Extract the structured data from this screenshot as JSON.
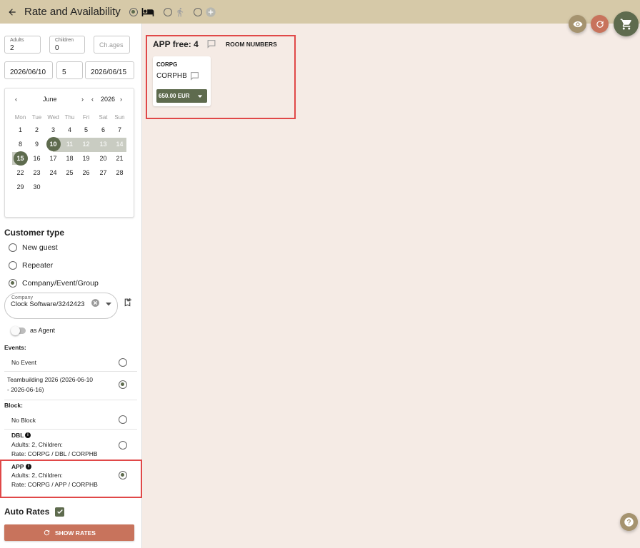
{
  "header": {
    "title": "Rate and Availability"
  },
  "guests": {
    "adults_label": "Adults",
    "adults_value": "2",
    "children_label": "Children",
    "children_value": "0",
    "child_ages_placeholder": "Ch.ages"
  },
  "dates": {
    "arrival": "2026/06/10",
    "nights": "5",
    "departure": "2026/06/15"
  },
  "calendar": {
    "month": "June",
    "year": "2026",
    "weekdays": [
      "Mon",
      "Tue",
      "Wed",
      "Thu",
      "Fri",
      "Sat",
      "Sun"
    ],
    "days": [
      "1",
      "2",
      "3",
      "4",
      "5",
      "6",
      "7",
      "8",
      "9",
      "10",
      "11",
      "12",
      "13",
      "14",
      "15",
      "16",
      "17",
      "18",
      "19",
      "20",
      "21",
      "22",
      "23",
      "24",
      "25",
      "26",
      "27",
      "28",
      "29",
      "30"
    ]
  },
  "customer": {
    "heading": "Customer type",
    "options": [
      "New guest",
      "Repeater",
      "Company/Event/Group"
    ],
    "company_label": "Company",
    "company_value": "Clock Software/3242423",
    "agent_label": "as Agent"
  },
  "events": {
    "label": "Events:",
    "items": [
      "No Event",
      "Teambuilding 2026 (2026-06-10",
      "- 2026-06-16)"
    ]
  },
  "block": {
    "label": "Block:",
    "no_block": "No Block",
    "dbl": {
      "name": "DBL",
      "line1": "Adults: 2, Children:",
      "line2": "Rate: CORPG / DBL / CORPHB"
    },
    "app": {
      "name": "APP",
      "line1": "Adults: 2, Children:",
      "line2": "Rate: CORPG / APP / CORPHB"
    }
  },
  "auto_rates": {
    "label": "Auto Rates"
  },
  "show_rates": {
    "label": "SHOW RATES"
  },
  "availability": {
    "room_type": "APP free: 4",
    "room_numbers": "ROOM NUMBERS",
    "rate_group": "CORPG",
    "rate_code": "CORPHB",
    "price": "650.00 EUR"
  },
  "colors": {
    "header_bg": "#d6c9a8",
    "accent_green": "#5e6b4e",
    "show_rates_bg": "#c8735c",
    "highlight_red": "#e04848"
  }
}
